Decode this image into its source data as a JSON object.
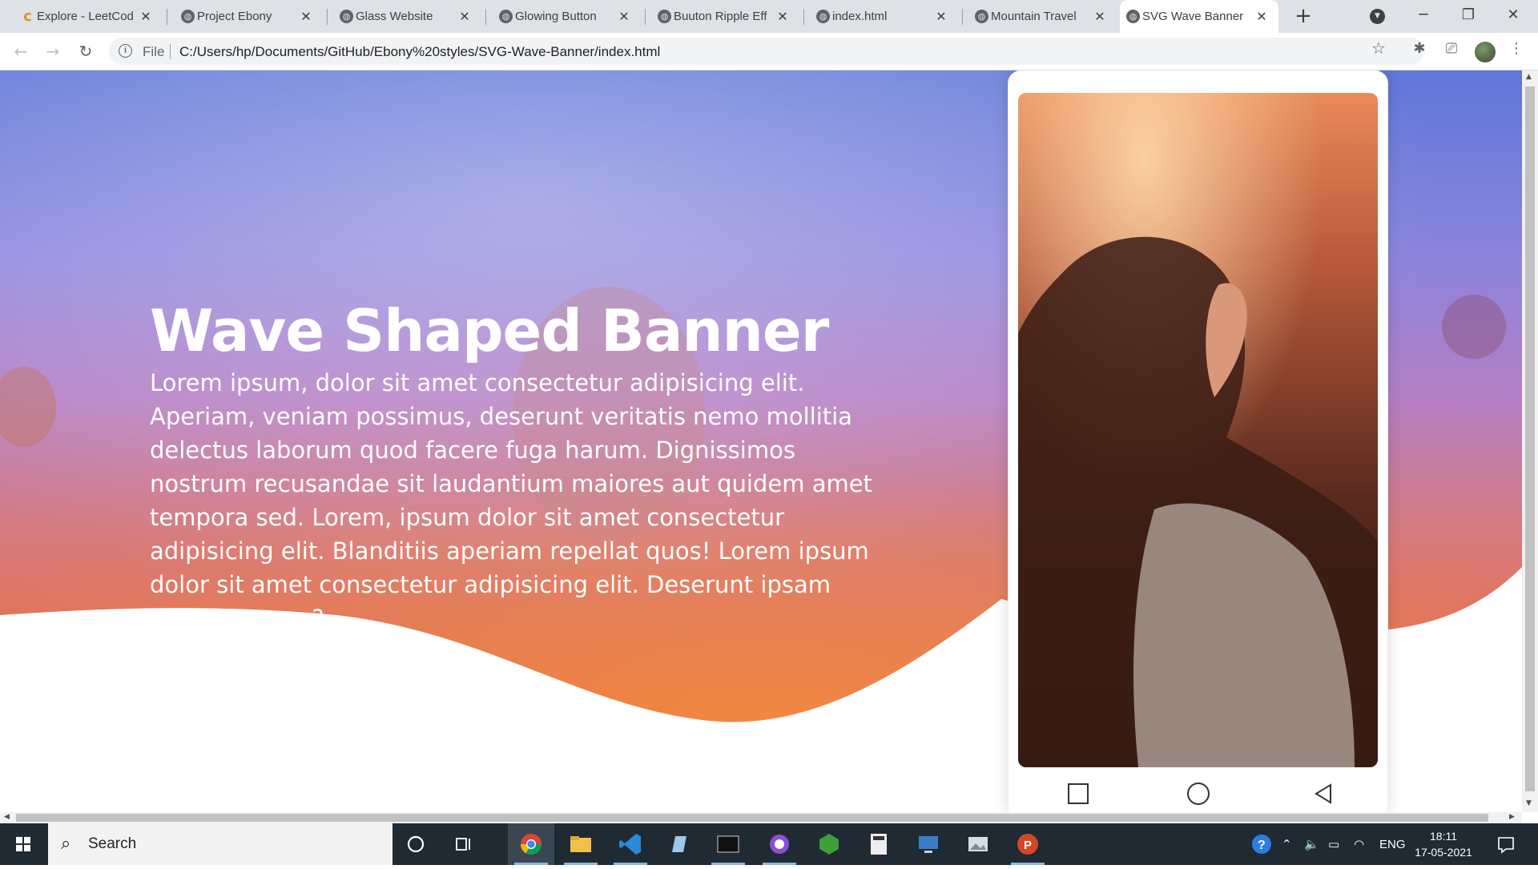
{
  "browser": {
    "tabs": [
      {
        "title": "Explore - LeetCod",
        "icon": "leetcode-icon",
        "active": false
      },
      {
        "title": "Project Ebony",
        "icon": "globe-icon",
        "active": false
      },
      {
        "title": "Glass Website",
        "icon": "globe-icon",
        "active": false
      },
      {
        "title": "Glowing Button",
        "icon": "globe-icon",
        "active": false
      },
      {
        "title": "Buuton Ripple Eff",
        "icon": "globe-icon",
        "active": false
      },
      {
        "title": "index.html",
        "icon": "globe-icon",
        "active": false
      },
      {
        "title": "Mountain Travel",
        "icon": "globe-icon",
        "active": false
      },
      {
        "title": "SVG Wave Banner",
        "icon": "globe-icon",
        "active": true
      }
    ],
    "address": {
      "scheme_label": "File",
      "url": "C:/Users/hp/Documents/GitHub/Ebony%20styles/SVG-Wave-Banner/index.html"
    }
  },
  "page": {
    "title": "Wave Shaped Banner",
    "body": "Lorem ipsum, dolor sit amet consectetur adipisicing elit. Aperiam, veniam possimus, deserunt veritatis nemo mollitia delectus laborum quod facere fuga harum. Dignissimos nostrum recusandae sit laudantium maiores aut quidem amet tempora sed. Lorem, ipsum dolor sit amet consectetur adipisicing elit. Blanditiis aperiam repellat quos! Lorem ipsum dolor sit amet consectetur adipisicing elit. Deserunt ipsam tempore error?"
  },
  "taskbar": {
    "search_label": "Search",
    "language": "ENG",
    "time": "18:11",
    "date": "17-05-2021"
  },
  "colors": {
    "banner_top": "#6b7fd6",
    "banner_mid": "#b07ad0",
    "banner_bottom": "#e8743e",
    "taskbar": "#1f2a33"
  }
}
